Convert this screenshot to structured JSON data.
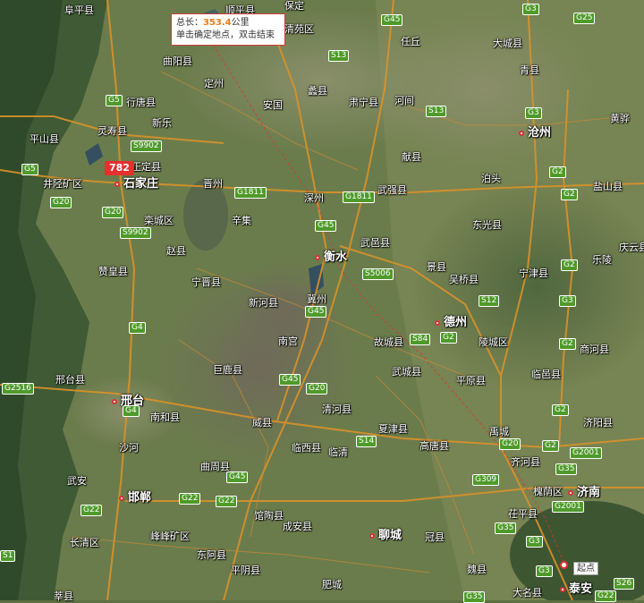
{
  "tooltip": {
    "total_label": "总长：",
    "total_value": "353.4",
    "unit": "公里",
    "hint": "单击确定地点，双击结束"
  },
  "distance_badge": "782",
  "start_label": "起点",
  "cities": [
    {
      "name": "石家庄",
      "big": true
    },
    {
      "name": "衡水",
      "big": true
    },
    {
      "name": "邢台",
      "big": true
    },
    {
      "name": "邯郸",
      "big": true
    },
    {
      "name": "沧州",
      "big": true
    },
    {
      "name": "德州",
      "big": true
    },
    {
      "name": "聊城",
      "big": true
    },
    {
      "name": "济南",
      "big": true
    },
    {
      "name": "泰安",
      "big": true
    },
    {
      "name": "阜平县"
    },
    {
      "name": "顺平县"
    },
    {
      "name": "保定"
    },
    {
      "name": "清苑区"
    },
    {
      "name": "任丘"
    },
    {
      "name": "大城县"
    },
    {
      "name": "青县"
    },
    {
      "name": "曲阳县"
    },
    {
      "name": "定州"
    },
    {
      "name": "蠡县"
    },
    {
      "name": "肃宁县"
    },
    {
      "name": "河间"
    },
    {
      "name": "黄骅"
    },
    {
      "name": "行唐县"
    },
    {
      "name": "灵寿县"
    },
    {
      "name": "新乐"
    },
    {
      "name": "安国"
    },
    {
      "name": "平山县"
    },
    {
      "name": "正定县"
    },
    {
      "name": "献县"
    },
    {
      "name": "井陉矿区"
    },
    {
      "name": "晋州"
    },
    {
      "name": "深州"
    },
    {
      "name": "武强县"
    },
    {
      "name": "泊头"
    },
    {
      "name": "盐山县"
    },
    {
      "name": "辛集"
    },
    {
      "name": "栾城区"
    },
    {
      "name": "东光县"
    },
    {
      "name": "赵县"
    },
    {
      "name": "武邑县"
    },
    {
      "name": "庆云县"
    },
    {
      "name": "乐陵"
    },
    {
      "name": "赞皇县"
    },
    {
      "name": "宁晋县"
    },
    {
      "name": "景县"
    },
    {
      "name": "吴桥县"
    },
    {
      "name": "宁津县"
    },
    {
      "name": "新河县"
    },
    {
      "name": "冀州"
    },
    {
      "name": "南宫"
    },
    {
      "name": "故城县"
    },
    {
      "name": "陵城区"
    },
    {
      "name": "商河县"
    },
    {
      "name": "巨鹿县"
    },
    {
      "name": "武城县"
    },
    {
      "name": "平原县"
    },
    {
      "name": "临邑县"
    },
    {
      "name": "邢台县"
    },
    {
      "name": "南和县"
    },
    {
      "name": "清河县"
    },
    {
      "name": "威县"
    },
    {
      "name": "夏津县"
    },
    {
      "name": "禹城"
    },
    {
      "name": "济阳县"
    },
    {
      "name": "沙河"
    },
    {
      "name": "临西县"
    },
    {
      "name": "临清"
    },
    {
      "name": "高唐县"
    },
    {
      "name": "齐河县"
    },
    {
      "name": "武安"
    },
    {
      "name": "曲周县"
    },
    {
      "name": "槐荫区"
    },
    {
      "name": "馆陶县"
    },
    {
      "name": "茌平县"
    },
    {
      "name": "长清区"
    },
    {
      "name": "峰峰矿区"
    },
    {
      "name": "成安县"
    },
    {
      "name": "冠县"
    },
    {
      "name": "东阿县"
    },
    {
      "name": "魏县"
    },
    {
      "name": "平阴县"
    },
    {
      "name": "大名县"
    },
    {
      "name": "肥城"
    },
    {
      "name": "莘县"
    },
    {
      "name": "安阳县"
    }
  ],
  "shields": [
    "G45",
    "G3",
    "G25",
    "S13",
    "G5",
    "S13",
    "G3",
    "S9902",
    "G5",
    "G1811",
    "G1811",
    "G2",
    "G20",
    "G20",
    "G45",
    "G2",
    "S9902",
    "G4",
    "S5006",
    "G2",
    "G45",
    "S12",
    "G2",
    "G3",
    "S84",
    "G2",
    "G4",
    "G2516",
    "G45",
    "G20",
    "G2",
    "S14",
    "G20",
    "G2",
    "G2001",
    "G35",
    "G309",
    "G22",
    "G22",
    "G22",
    "G45",
    "G35",
    "G2001",
    "G3",
    "G3",
    "G35",
    "S26",
    "G22",
    "S1"
  ]
}
